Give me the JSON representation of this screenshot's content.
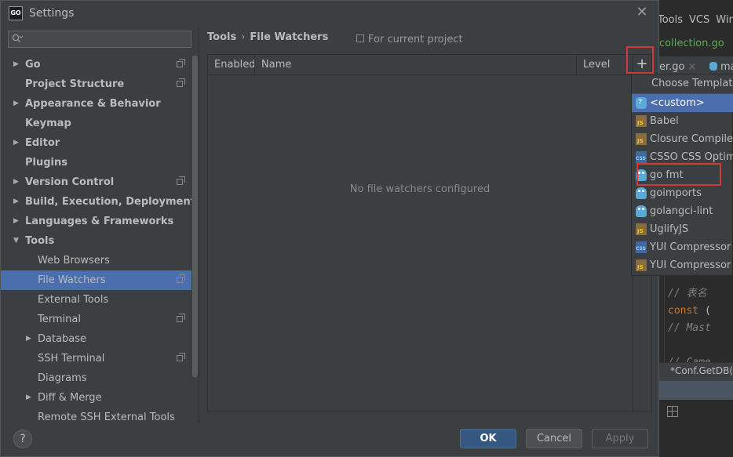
{
  "window": {
    "title": "Settings",
    "app_icon_text": "GO",
    "close_glyph": "✕"
  },
  "search": {
    "placeholder": "",
    "icon": "search-icon"
  },
  "sidebar": {
    "items": [
      {
        "label": "Go",
        "bold": true,
        "expandable": true,
        "project": true
      },
      {
        "label": "Project Structure",
        "bold": true,
        "expandable": false,
        "project": true
      },
      {
        "label": "Appearance & Behavior",
        "bold": true,
        "expandable": true,
        "project": false
      },
      {
        "label": "Keymap",
        "bold": true,
        "expandable": false,
        "project": false
      },
      {
        "label": "Editor",
        "bold": true,
        "expandable": true,
        "project": false
      },
      {
        "label": "Plugins",
        "bold": true,
        "expandable": false,
        "project": false
      },
      {
        "label": "Version Control",
        "bold": true,
        "expandable": true,
        "project": true
      },
      {
        "label": "Build, Execution, Deployment",
        "bold": true,
        "expandable": true,
        "project": false
      },
      {
        "label": "Languages & Frameworks",
        "bold": true,
        "expandable": true,
        "project": false
      },
      {
        "label": "Tools",
        "bold": true,
        "expandable": true,
        "expanded": true,
        "project": false
      },
      {
        "label": "Web Browsers",
        "bold": false,
        "child": true,
        "project": false
      },
      {
        "label": "File Watchers",
        "bold": false,
        "child": true,
        "selected": true,
        "project": true
      },
      {
        "label": "External Tools",
        "bold": false,
        "child": true,
        "project": false
      },
      {
        "label": "Terminal",
        "bold": false,
        "child": true,
        "project": true
      },
      {
        "label": "Database",
        "bold": false,
        "child": true,
        "expandable": true,
        "project": false
      },
      {
        "label": "SSH Terminal",
        "bold": false,
        "child": true,
        "project": true
      },
      {
        "label": "Diagrams",
        "bold": false,
        "child": true,
        "project": false
      },
      {
        "label": "Diff & Merge",
        "bold": false,
        "child": true,
        "expandable": true,
        "project": false
      },
      {
        "label": "Remote SSH External Tools",
        "bold": false,
        "child": true,
        "project": false
      }
    ]
  },
  "breadcrumb": {
    "parent": "Tools",
    "separator": "›",
    "current": "File Watchers"
  },
  "scope_note": "For current project",
  "table": {
    "columns": [
      "Enabled",
      "Name",
      "Level"
    ],
    "empty_text": "No file watchers configured",
    "add_glyph": "+"
  },
  "dropdown": {
    "title": "Choose Template",
    "items": [
      {
        "label": "<custom>",
        "icon": "custom",
        "selected": true
      },
      {
        "label": "Babel",
        "icon": "js"
      },
      {
        "label": "Closure Compiler",
        "icon": "js"
      },
      {
        "label": "CSSO CSS Optimizer",
        "icon": "css"
      },
      {
        "label": "go fmt",
        "icon": "gopher",
        "highlighted": true
      },
      {
        "label": "goimports",
        "icon": "gopher"
      },
      {
        "label": "golangci-lint",
        "icon": "gopher"
      },
      {
        "label": "UglifyJS",
        "icon": "js"
      },
      {
        "label": "YUI Compressor CSS",
        "icon": "css"
      },
      {
        "label": "YUI Compressor JS",
        "icon": "js"
      }
    ]
  },
  "buttons": {
    "help": "?",
    "ok": "OK",
    "cancel": "Cancel",
    "apply": "Apply"
  },
  "background_ide": {
    "menu": [
      "Tools",
      "VCS",
      "Window"
    ],
    "file_title": "collection.go",
    "tab1": "er.go",
    "tab1_close": "×",
    "tab2": "ma",
    "code": [
      {
        "text": "// 表名",
        "kind": "comment"
      },
      {
        "text": "const (",
        "kind": "keyword"
      },
      {
        "text": "    // Mast",
        "kind": "comment"
      },
      {
        "text": "",
        "kind": "plain"
      },
      {
        "text": "    // Came",
        "kind": "comment"
      }
    ],
    "status_text": "*Conf.GetDB()"
  },
  "colors": {
    "selection": "#4b6eaf",
    "highlight_box": "#d03a3a",
    "primary_button": "#365880",
    "panel_bg": "#3c3f41"
  }
}
